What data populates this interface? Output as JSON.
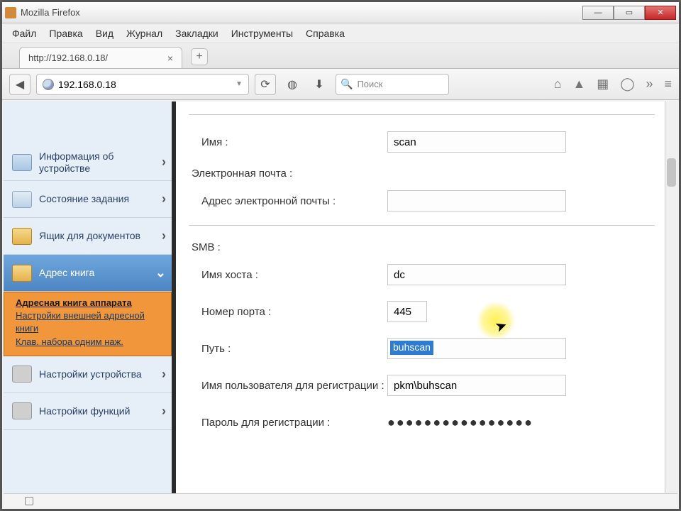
{
  "window": {
    "title": "Mozilla Firefox"
  },
  "menubar": [
    "Файл",
    "Правка",
    "Вид",
    "Журнал",
    "Закладки",
    "Инструменты",
    "Справка"
  ],
  "tab": {
    "label": "http://192.168.0.18/"
  },
  "url": "192.168.0.18",
  "search": {
    "placeholder": "Поиск"
  },
  "sidebar": {
    "items": [
      {
        "label": "Информация об устройстве"
      },
      {
        "label": "Состояние задания"
      },
      {
        "label": "Ящик для документов"
      },
      {
        "label": "Адрес книга"
      },
      {
        "label": "Настройки устройства"
      },
      {
        "label": "Настройки функций"
      }
    ],
    "sub": [
      "Адресная книга аппарата",
      "Настройки внешней адресной книги",
      "Клав. набора одним наж."
    ]
  },
  "form": {
    "name_label": "Имя :",
    "name_value": "scan",
    "email_section": "Электронная почта :",
    "email_label": "Адрес электронной почты :",
    "email_value": "",
    "smb_section": "SMB :",
    "host_label": "Имя хоста :",
    "host_value": "dc",
    "port_label": "Номер порта :",
    "port_value": "445",
    "path_label": "Путь :",
    "path_value": "buhscan",
    "user_label": "Имя пользователя для регистрации :",
    "user_value": "pkm\\buhscan",
    "pass_label": "Пароль для регистрации :",
    "pass_value": "●●●●●●●●●●●●●●●●"
  }
}
